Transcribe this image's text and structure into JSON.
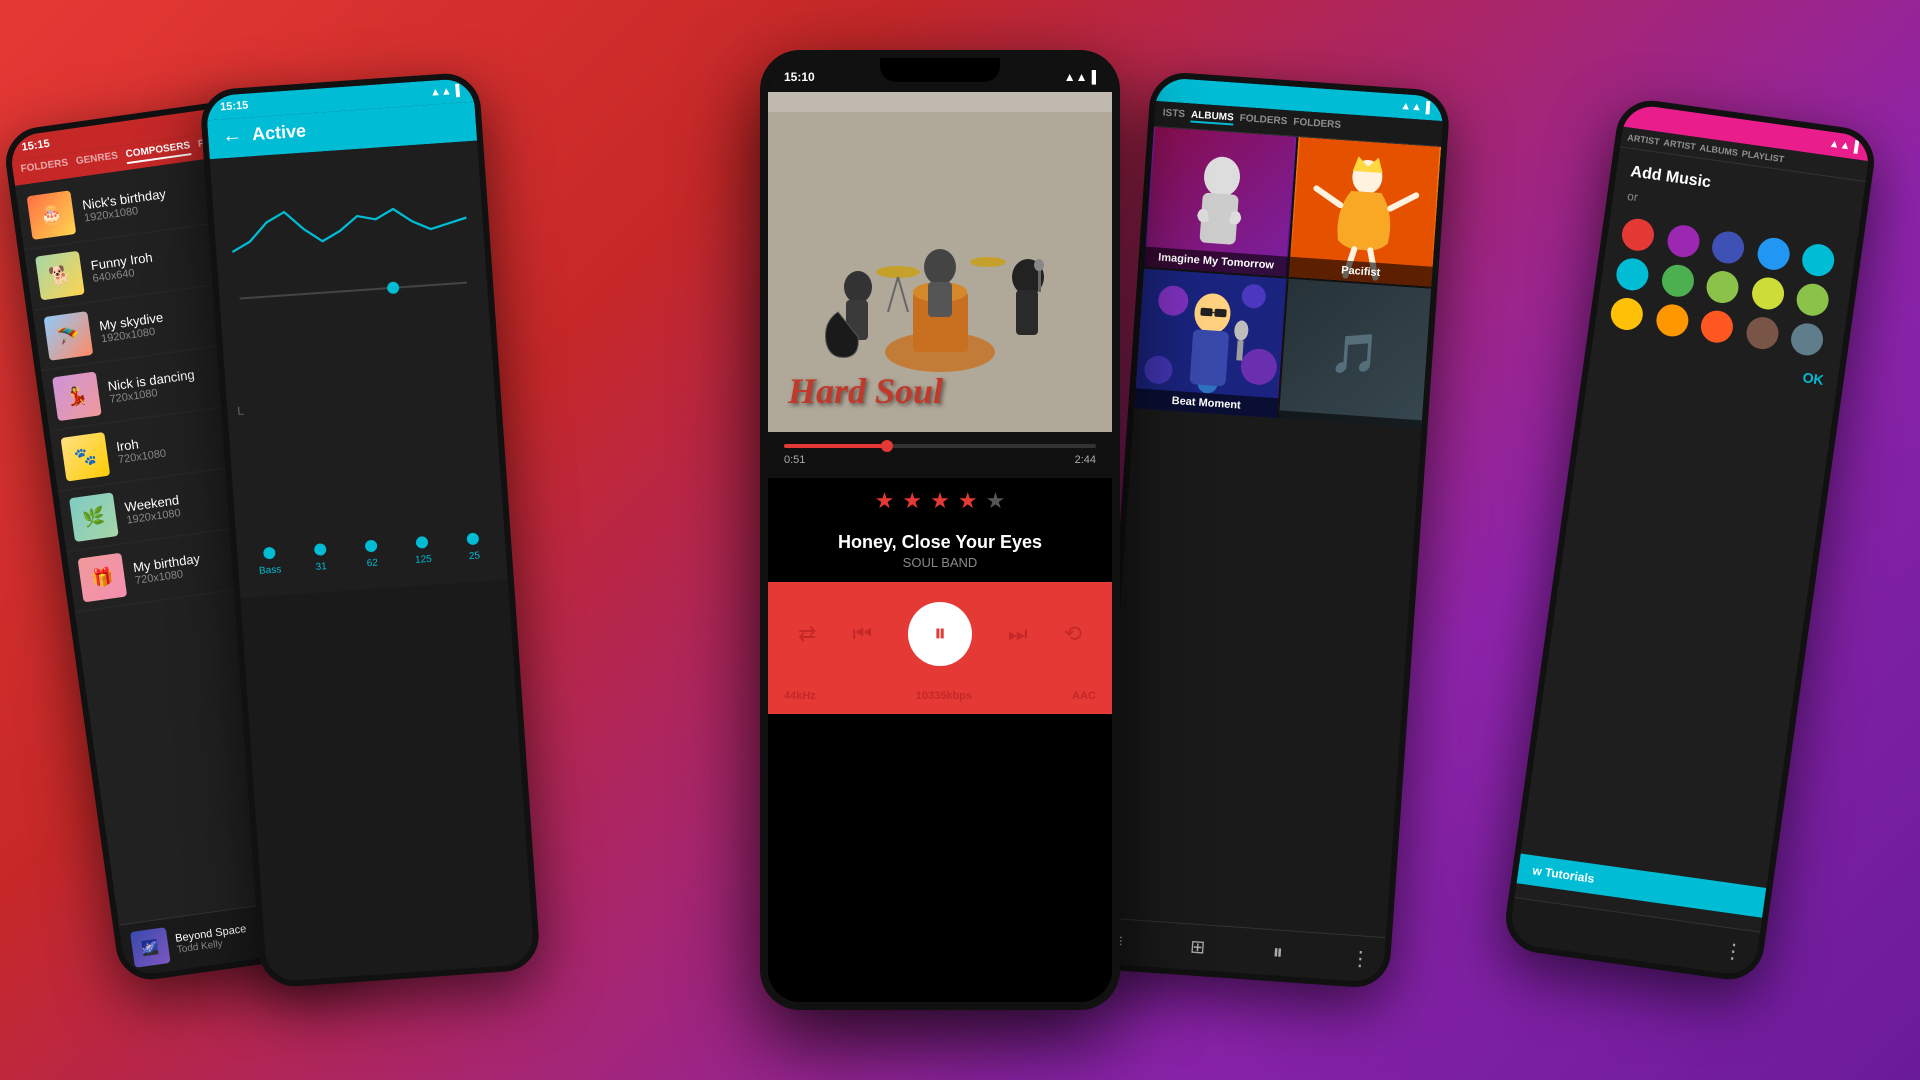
{
  "background": {
    "gradient": "135deg, #e53935, #c62828, #8e24aa, #6a1b9a"
  },
  "phone1": {
    "status_bar": {
      "time": "15:15",
      "icons": "signal wifi battery"
    },
    "tabs": [
      "FOLDERS",
      "GENRES",
      "COMPOSERS",
      "P..."
    ],
    "active_tab": "COMPOSERS",
    "items": [
      {
        "title": "Nick's birthday",
        "subtitle": "1920x1080",
        "emoji": "🎂"
      },
      {
        "title": "Funny Iroh",
        "subtitle": "640x640",
        "emoji": "🐕"
      },
      {
        "title": "My skydive",
        "subtitle": "1920x1080",
        "emoji": "🪂"
      },
      {
        "title": "Nick is dancing",
        "subtitle": "720x1080",
        "emoji": "💃"
      },
      {
        "title": "Iroh",
        "subtitle": "720x1080",
        "emoji": "🐾"
      },
      {
        "title": "Weekend",
        "subtitle": "1920x1080",
        "emoji": "🌿"
      },
      {
        "title": "My birthday",
        "subtitle": "720x1080",
        "emoji": "🎁"
      }
    ],
    "bottom_track": {
      "title": "Beyond Space",
      "artist": "Todd Kelly",
      "emoji": "🌌"
    }
  },
  "phone2": {
    "status_bar": {
      "time": "15:15",
      "icons": "signal wifi battery"
    },
    "header": {
      "back_label": "←",
      "title": "Active"
    },
    "equalizer": {
      "bands": [
        "Bass",
        "31",
        "62",
        "125",
        "25"
      ],
      "dot_positions": [
        0.6,
        0.4,
        0.55,
        0.35,
        0.5
      ],
      "l_label": "L"
    }
  },
  "phone3": {
    "status_bar": {
      "time": "15:10",
      "icons": "signal wifi battery"
    },
    "album": {
      "art_text": "Hard Soul",
      "band_desc": "Rock band with guitarist, drummer, and singer"
    },
    "progress": {
      "current": "0:51",
      "total": "2:44",
      "percent": 33
    },
    "rating": {
      "stars": 4,
      "max_stars": 5
    },
    "track": {
      "title": "Honey, Close Your Eyes",
      "artist": "SOUL BAND"
    },
    "controls": {
      "shuffle": "⇄",
      "prev": "⏮",
      "play_pause": "⏸",
      "next": "⏭",
      "repeat": "⟲"
    },
    "footer": {
      "quality": "44kHz",
      "bitrate": "10335kbps",
      "format": "AAC"
    }
  },
  "phone4": {
    "status_bar": {
      "icons": "signal wifi battery"
    },
    "tabs": [
      "ISTS",
      "ALBUMS",
      "FOLDERS",
      "FOLDERS"
    ],
    "active_tab": "ALBUMS",
    "albums": [
      {
        "title": "Imagine My Tomorrow",
        "type": "singer_red"
      },
      {
        "title": "Pacifist",
        "type": "dancer"
      },
      {
        "title": "Beat Moment",
        "type": "singer_blue"
      },
      {
        "title": "",
        "type": "concert"
      }
    ],
    "bottom_icons": [
      "≡",
      "⊞",
      "⏸",
      "⋮"
    ]
  },
  "phone5": {
    "status_bar": {
      "icons": "signal wifi battery"
    },
    "tabs": [
      "ARTIST",
      "ARTIST",
      "ALBUMS",
      "PLAYLIST"
    ],
    "add_music": {
      "title": "Add Music",
      "or_label": "or",
      "ok_label": "OK"
    },
    "colors": [
      "#e53935",
      "#9c27b0",
      "#3f51b5",
      "#03a9f4",
      "#00bcd4",
      "#00bcd4",
      "#4caf50",
      "#8bc34a",
      "#cddc39",
      "#ffeb3b",
      "#ff9800",
      "#ff5722",
      "#795548",
      "#9e9e9e",
      "#607d8b"
    ],
    "tutorials_label": "w Tutorials",
    "bottom_icons": [
      "⋮"
    ]
  }
}
